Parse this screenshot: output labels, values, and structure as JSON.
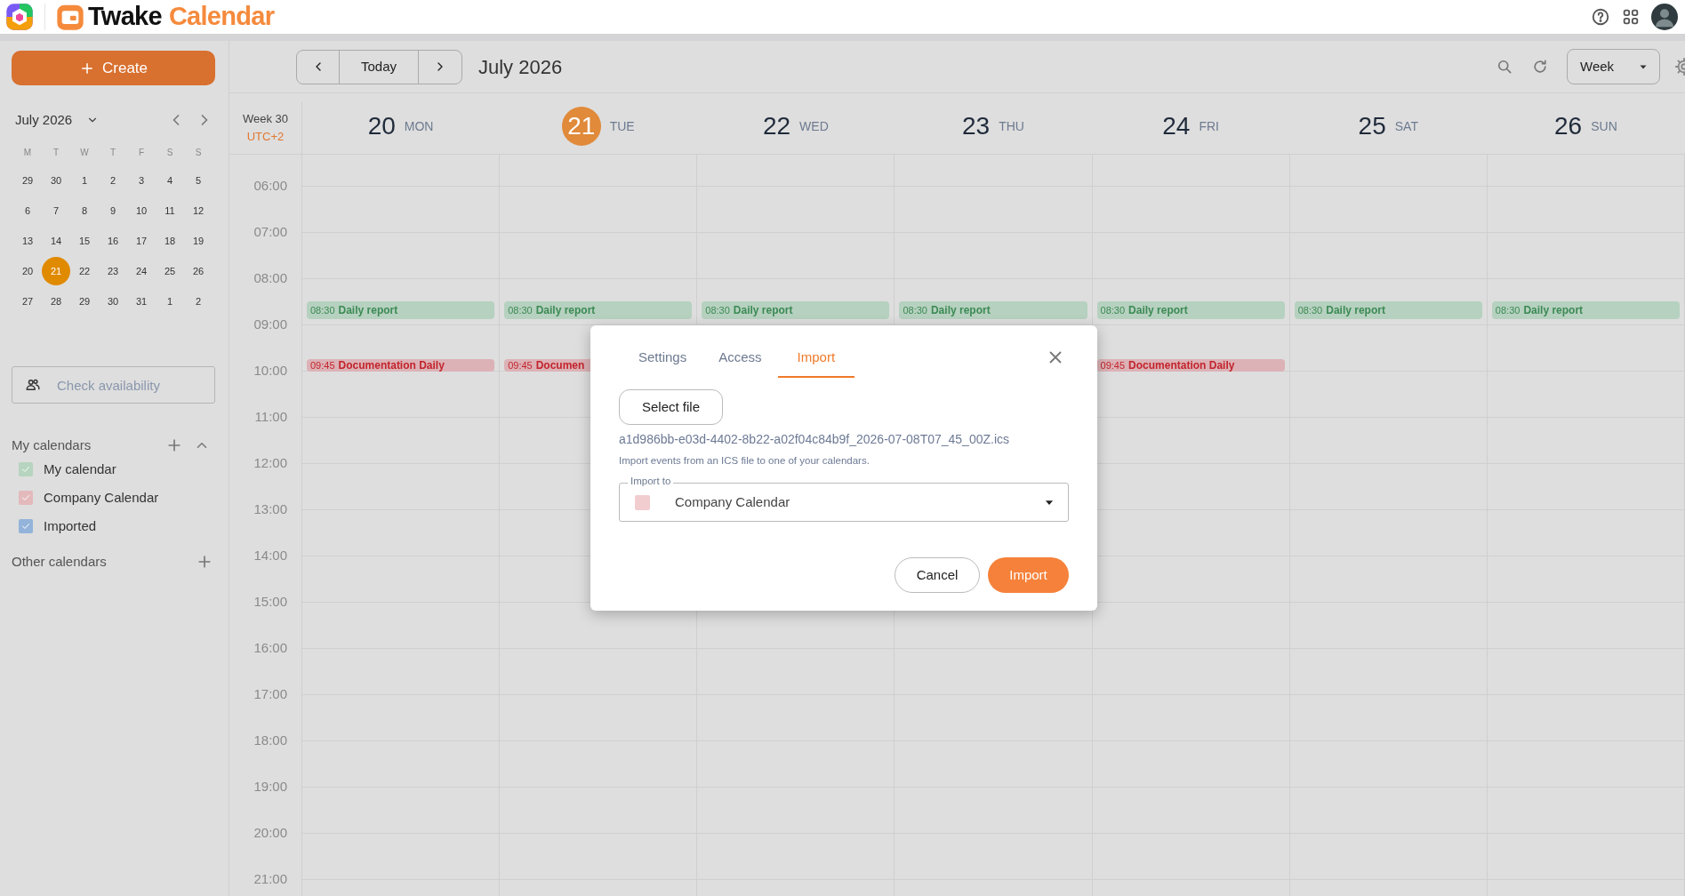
{
  "header": {
    "brand_first": "Twake",
    "brand_second": "Calendar"
  },
  "sidebar": {
    "create_label": "Create",
    "mini_calendar": {
      "title": "July 2026",
      "weekdays": [
        "M",
        "T",
        "W",
        "T",
        "F",
        "S",
        "S"
      ],
      "weeks": [
        [
          {
            "day": "29",
            "selected": false
          },
          {
            "day": "30",
            "selected": false
          },
          {
            "day": "1",
            "selected": false
          },
          {
            "day": "2",
            "selected": false
          },
          {
            "day": "3",
            "selected": false
          },
          {
            "day": "4",
            "selected": false
          },
          {
            "day": "5",
            "selected": false
          }
        ],
        [
          {
            "day": "6",
            "selected": false
          },
          {
            "day": "7",
            "selected": false
          },
          {
            "day": "8",
            "selected": false
          },
          {
            "day": "9",
            "selected": false
          },
          {
            "day": "10",
            "selected": false
          },
          {
            "day": "11",
            "selected": false
          },
          {
            "day": "12",
            "selected": false
          }
        ],
        [
          {
            "day": "13",
            "selected": false
          },
          {
            "day": "14",
            "selected": false
          },
          {
            "day": "15",
            "selected": false
          },
          {
            "day": "16",
            "selected": false
          },
          {
            "day": "17",
            "selected": false
          },
          {
            "day": "18",
            "selected": false
          },
          {
            "day": "19",
            "selected": false
          }
        ],
        [
          {
            "day": "20",
            "selected": false
          },
          {
            "day": "21",
            "selected": true
          },
          {
            "day": "22",
            "selected": false
          },
          {
            "day": "23",
            "selected": false
          },
          {
            "day": "24",
            "selected": false
          },
          {
            "day": "25",
            "selected": false
          },
          {
            "day": "26",
            "selected": false
          }
        ],
        [
          {
            "day": "27",
            "selected": false
          },
          {
            "day": "28",
            "selected": false
          },
          {
            "day": "29",
            "selected": false
          },
          {
            "day": "30",
            "selected": false
          },
          {
            "day": "31",
            "selected": false
          },
          {
            "day": "1",
            "selected": false
          },
          {
            "day": "2",
            "selected": false
          }
        ]
      ]
    },
    "availability_placeholder": "Check availability",
    "my_calendars": {
      "title": "My calendars",
      "items": [
        {
          "label": "My calendar",
          "color": "#b6d4bf",
          "checked": true
        },
        {
          "label": "Company Calendar",
          "color": "#e3b9bc",
          "checked": true
        },
        {
          "label": "Imported",
          "color": "#93b3da",
          "checked": true
        }
      ]
    },
    "other_calendars": {
      "title": "Other calendars"
    }
  },
  "toolbar": {
    "today": "Today",
    "title": "July 2026",
    "view": "Week"
  },
  "week": {
    "week_label": "Week 30",
    "timezone": "UTC+2",
    "hours": [
      "06:00",
      "07:00",
      "08:00",
      "09:00",
      "10:00",
      "11:00",
      "12:00",
      "13:00",
      "14:00",
      "15:00",
      "16:00",
      "17:00",
      "18:00",
      "19:00",
      "20:00",
      "21:00"
    ],
    "days": [
      {
        "date": "20",
        "weekday": "MON",
        "selected": false,
        "events": [
          {
            "time": "08:30",
            "title": "Daily report",
            "kind": "report"
          },
          {
            "time": "09:45",
            "title": "Documentation Daily",
            "kind": "documentation"
          }
        ]
      },
      {
        "date": "21",
        "weekday": "TUE",
        "selected": true,
        "events": [
          {
            "time": "08:30",
            "title": "Daily report",
            "kind": "report"
          },
          {
            "time": "09:45",
            "title": "Documen",
            "kind": "documentation"
          }
        ]
      },
      {
        "date": "22",
        "weekday": "WED",
        "selected": false,
        "events": [
          {
            "time": "08:30",
            "title": "Daily report",
            "kind": "report"
          }
        ]
      },
      {
        "date": "23",
        "weekday": "THU",
        "selected": false,
        "events": [
          {
            "time": "08:30",
            "title": "Daily report",
            "kind": "report"
          }
        ]
      },
      {
        "date": "24",
        "weekday": "FRI",
        "selected": false,
        "events": [
          {
            "time": "08:30",
            "title": "Daily report",
            "kind": "report"
          },
          {
            "time": "09:45",
            "title": "Documentation Daily",
            "kind": "documentation"
          }
        ]
      },
      {
        "date": "25",
        "weekday": "SAT",
        "selected": false,
        "events": [
          {
            "time": "08:30",
            "title": "Daily report",
            "kind": "report"
          }
        ]
      },
      {
        "date": "26",
        "weekday": "SUN",
        "selected": false,
        "events": [
          {
            "time": "08:30",
            "title": "Daily report",
            "kind": "report"
          }
        ]
      }
    ]
  },
  "dialog": {
    "tabs": [
      {
        "label": "Settings",
        "selected": false
      },
      {
        "label": "Access",
        "selected": false
      },
      {
        "label": "Import",
        "selected": true
      }
    ],
    "select_file": "Select file",
    "file_name": "a1d986bb-e03d-4402-8b22-a02f04c84b9f_2026-07-08T07_45_00Z.ics",
    "description": "Import events from an ICS file to one of your calendars.",
    "import_to": {
      "label": "Import to",
      "value": "Company Calendar",
      "color": "#f2cdd0"
    },
    "cancel": "Cancel",
    "confirm": "Import"
  }
}
